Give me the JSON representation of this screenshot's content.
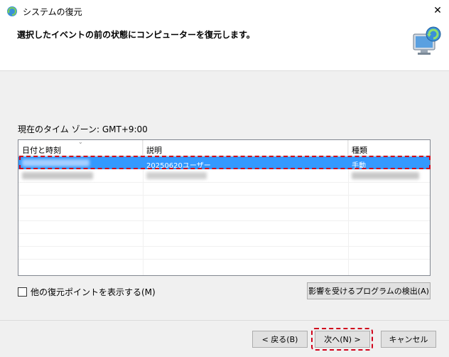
{
  "window": {
    "title": "システムの復元",
    "close_glyph": "✕"
  },
  "instruction": "選択したイベントの前の状態にコンピューターを復元します。",
  "timezone_label": "現在のタイム ゾーン: GMT+9:00",
  "table": {
    "columns": [
      "日付と時刻",
      "説明",
      "種類"
    ],
    "rows": [
      {
        "datetime": "",
        "description": "20250620ユーザー",
        "type": "手動",
        "selected": true
      },
      {
        "datetime": "",
        "description": "",
        "type": "",
        "selected": false
      }
    ]
  },
  "show_more_label": "他の復元ポイントを表示する(M)",
  "buttons": {
    "scan": "影響を受けるプログラムの検出(A)",
    "back": "< 戻る(B)",
    "next": "次へ(N) >",
    "cancel": "キャンセル"
  },
  "colors": {
    "selection": "#3399ff",
    "highlight_dash": "#d0021b"
  }
}
